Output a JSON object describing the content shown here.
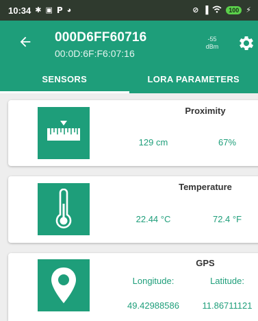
{
  "status_bar": {
    "time": "10:34",
    "left_icons": [
      "bluetooth-icon",
      "screen-icon",
      "p-icon",
      "circle-icon"
    ],
    "right_icons": [
      "alarm-off-icon",
      "cellular-signal-icon",
      "wifi-icon",
      "battery-icon",
      "charging-icon"
    ],
    "battery": "100"
  },
  "app_bar": {
    "device_name": "000D6FF60716",
    "device_mac": "00:0D:6F:F6:07:16",
    "signal_value": "-55",
    "signal_unit": "dBm"
  },
  "tabs": [
    {
      "label": "SENSORS",
      "active": true
    },
    {
      "label": "LORA PARAMETERS",
      "active": false
    }
  ],
  "cards": {
    "proximity": {
      "title": "Proximity",
      "value_left": "129 cm",
      "value_right": "67%",
      "icon": "ruler-icon"
    },
    "temperature": {
      "title": "Temperature",
      "value_left": "22.44 °C",
      "value_right": "72.4 °F",
      "icon": "thermometer-icon"
    },
    "gps": {
      "title": "GPS",
      "label_left": "Longitude:",
      "label_right": "Latitude:",
      "value_left": "49.42988586",
      "value_right": "11.86711121",
      "icon": "location-pin-icon"
    }
  },
  "colors": {
    "accent": "#1e9e7a",
    "status_bar": "#2f3a2e",
    "background": "#eeeeee",
    "card": "#ffffff"
  }
}
